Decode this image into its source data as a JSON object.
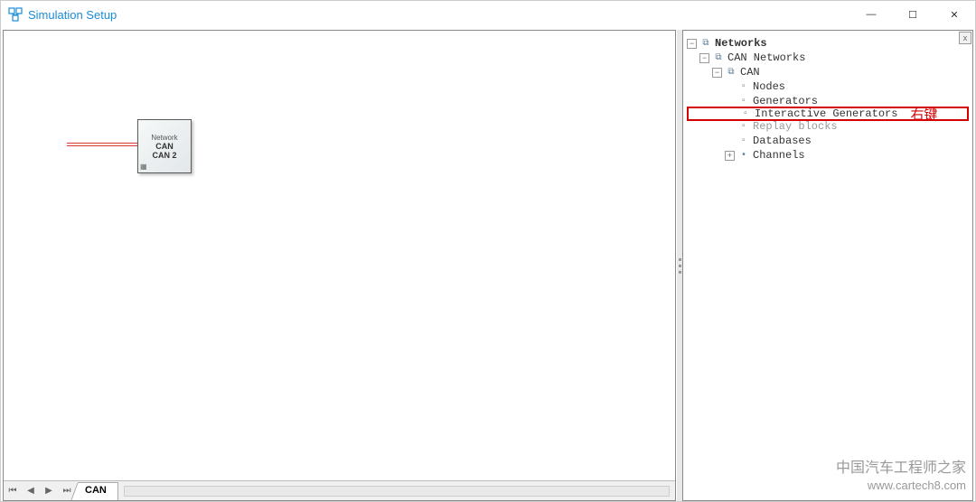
{
  "window": {
    "title": "Simulation Setup",
    "minimize_glyph": "—",
    "maximize_glyph": "☐",
    "close_glyph": "✕"
  },
  "canvas": {
    "node": {
      "line1": "Network",
      "line2": "CAN",
      "line3": "CAN 2"
    },
    "tabs": {
      "first_glyph": "⏮",
      "prev_glyph": "◀",
      "next_glyph": "▶",
      "last_glyph": "⏭",
      "active_tab": "CAN"
    }
  },
  "tree": {
    "close_glyph": "x",
    "minus_glyph": "−",
    "plus_glyph": "+",
    "dot_glyph": "•",
    "items": {
      "root": "Networks",
      "can_networks": "CAN Networks",
      "can": "CAN",
      "nodes": "Nodes",
      "generators": "Generators",
      "interactive_generators": "Interactive Generators",
      "replay_blocks": "Replay blocks",
      "databases": "Databases",
      "channels": "Channels"
    },
    "annotation": "右键"
  },
  "watermark": {
    "line1": "中国汽车工程师之家",
    "line2": "www.cartech8.com"
  }
}
